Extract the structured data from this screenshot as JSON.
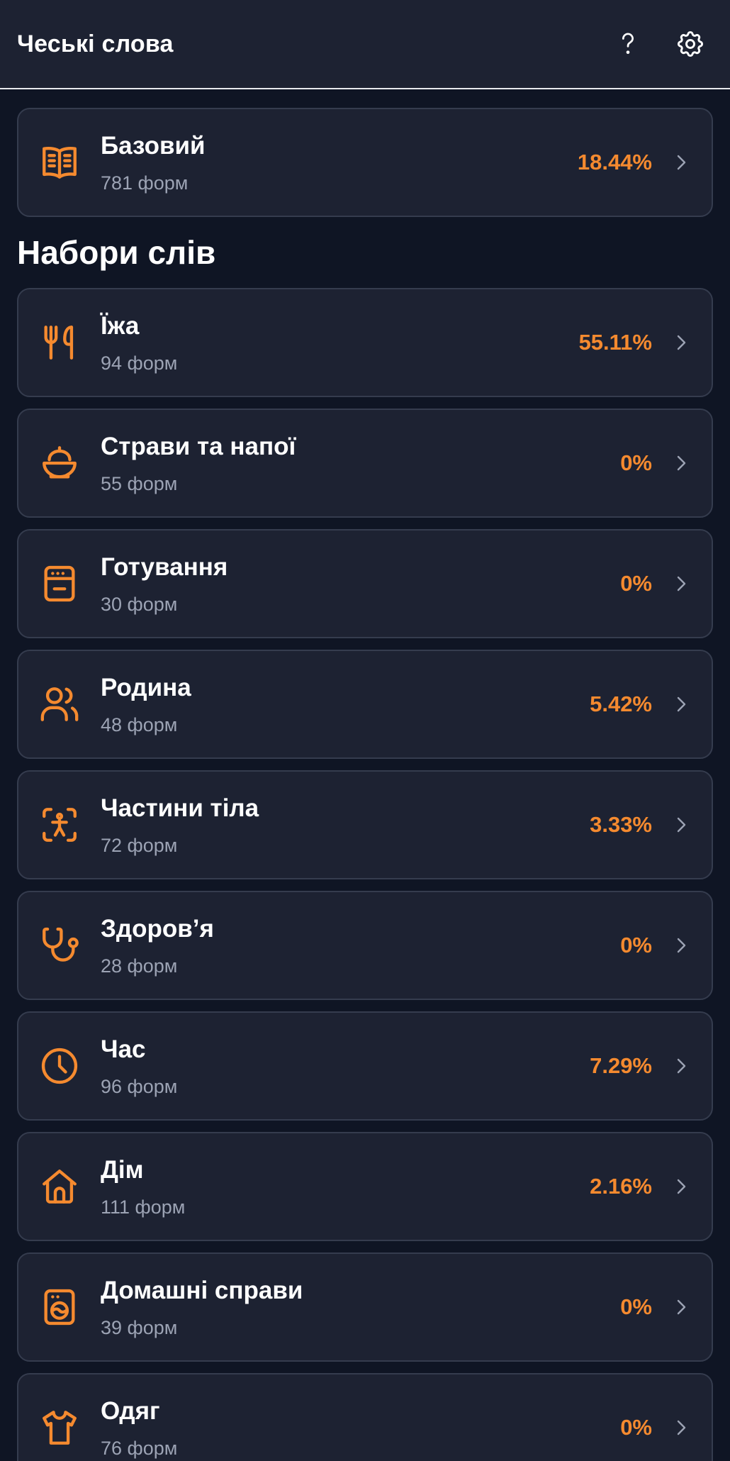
{
  "header": {
    "title": "Чеські слова",
    "help_icon": "question-mark-icon",
    "settings_icon": "gear-icon"
  },
  "accent_color": "#f58a2f",
  "featured": {
    "title": "Базовий",
    "subtitle": "781 форм",
    "percent": "18.44%",
    "icon": "book-icon"
  },
  "section_title": "Набори слів",
  "sets": [
    {
      "title": "Їжа",
      "subtitle": "94 форм",
      "percent": "55.11%",
      "icon": "utensils-icon"
    },
    {
      "title": "Страви та напої",
      "subtitle": "55 форм",
      "percent": "0%",
      "icon": "bowl-icon"
    },
    {
      "title": "Готування",
      "subtitle": "30 форм",
      "percent": "0%",
      "icon": "oven-icon"
    },
    {
      "title": "Родина",
      "subtitle": "48 форм",
      "percent": "5.42%",
      "icon": "users-icon"
    },
    {
      "title": "Частини тіла",
      "subtitle": "72 форм",
      "percent": "3.33%",
      "icon": "body-scan-icon"
    },
    {
      "title": "Здоров’я",
      "subtitle": "28 форм",
      "percent": "0%",
      "icon": "stethoscope-icon"
    },
    {
      "title": "Час",
      "subtitle": "96 форм",
      "percent": "7.29%",
      "icon": "clock-icon"
    },
    {
      "title": "Дім",
      "subtitle": "111 форм",
      "percent": "2.16%",
      "icon": "house-icon"
    },
    {
      "title": "Домашні справи",
      "subtitle": "39 форм",
      "percent": "0%",
      "icon": "washing-machine-icon"
    },
    {
      "title": "Одяг",
      "subtitle": "76 форм",
      "percent": "0%",
      "icon": "shirt-icon"
    }
  ]
}
